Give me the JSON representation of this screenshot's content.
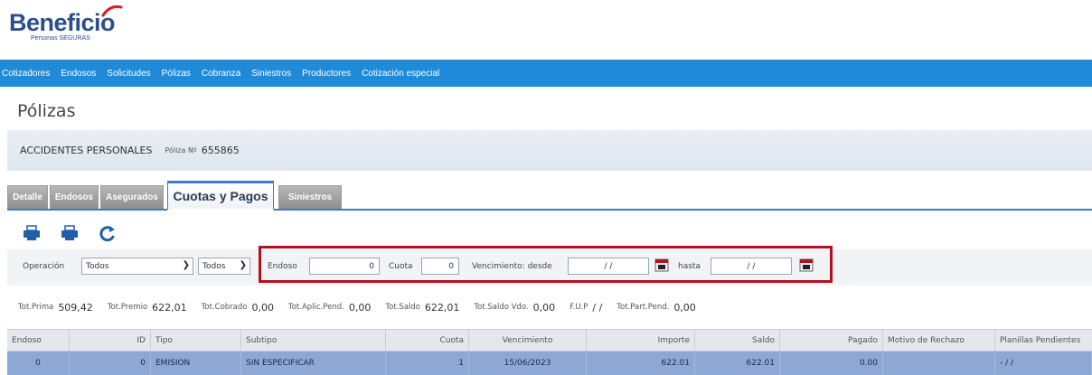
{
  "brand": {
    "name": "Beneficio",
    "tagline": "Personas SEGURAS",
    "accent": "#d0202a",
    "primary": "#2b4f8c"
  },
  "menu": {
    "items": [
      "Cotizadores",
      "Endosos",
      "Solicitudes",
      "Pólizas",
      "Cobranza",
      "Siniestros",
      "Productores",
      "Cotización especial"
    ],
    "background": "#1f8bd8"
  },
  "page": {
    "title": "Pólizas"
  },
  "policy": {
    "type": "ACCIDENTES PERSONALES",
    "number_label": "Póliza Nº",
    "number": "655865"
  },
  "tabs": [
    {
      "label": "Detalle",
      "active": false
    },
    {
      "label": "Endosos",
      "active": false
    },
    {
      "label": "Asegurados",
      "active": false
    },
    {
      "label": "Cuotas y Pagos",
      "active": true
    },
    {
      "label": "Siniestros",
      "active": false
    }
  ],
  "toolbar": {
    "icons": [
      "print-icon",
      "print-icon",
      "refresh-icon"
    ]
  },
  "filters": {
    "operacion_label": "Operación",
    "operacion_value": "Todos",
    "second_select_value": "Todos",
    "endoso_label": "Endoso",
    "endoso_value": "0",
    "cuota_label": "Cuota",
    "cuota_value": "0",
    "vencimiento_desde_label": "Vencimiento: desde",
    "vencimiento_desde_value": "/ /",
    "hasta_label": "hasta",
    "hasta_value": "/ /"
  },
  "totals": [
    {
      "label": "Tot.Prima",
      "value": "509,42"
    },
    {
      "label": "Tot.Premio",
      "value": "622,01"
    },
    {
      "label": "Tot.Cobrado",
      "value": "0,00"
    },
    {
      "label": "Tot.Aplic.Pend.",
      "value": "0,00"
    },
    {
      "label": "Tot.Saldo",
      "value": "622,01"
    },
    {
      "label": "Tot.Saldo Vdo.",
      "value": "0,00"
    },
    {
      "label": "F.U.P",
      "value": "/ /"
    },
    {
      "label": "Tot.Part.Pend.",
      "value": "0,00"
    }
  ],
  "table": {
    "columns": [
      "Endoso",
      "ID",
      "Tipo",
      "Subtipo",
      "Cuota",
      "Vencimiento",
      "Importe",
      "Saldo",
      "Pagado",
      "Motivo de Rechazo",
      "Planillas Pendientes"
    ],
    "rows": [
      [
        "0",
        "0",
        "EMISION",
        "SIN ESPECIFICAR",
        "1",
        "15/06/2023",
        "622.01",
        "622.01",
        "0.00",
        "",
        "- / /"
      ]
    ]
  }
}
